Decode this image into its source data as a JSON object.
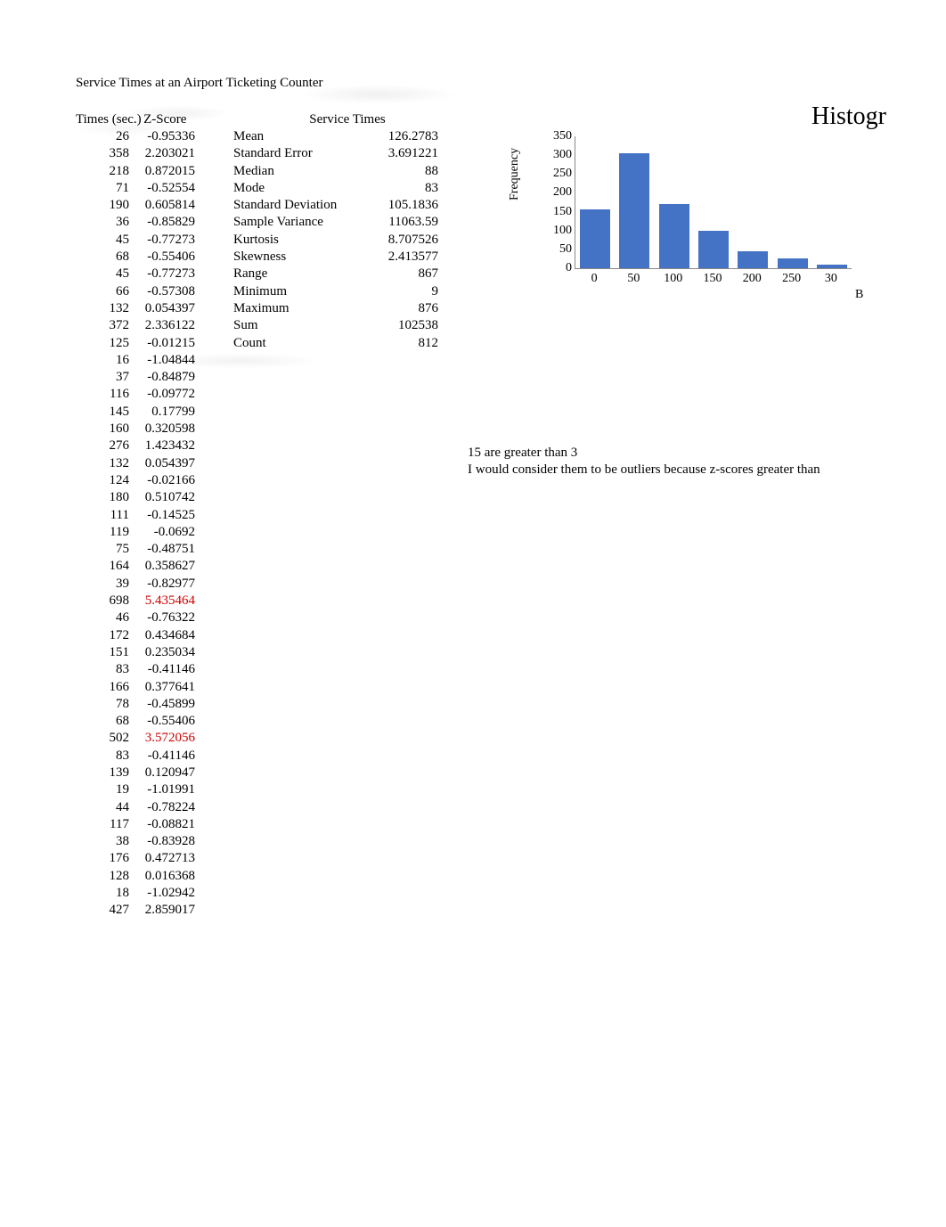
{
  "title": "Service Times at an Airport Ticketing Counter",
  "headers": {
    "times": "Times (sec.)",
    "zscore": "Z-Score"
  },
  "rows": [
    {
      "t": "26",
      "z": "-0.95336"
    },
    {
      "t": "358",
      "z": "2.203021"
    },
    {
      "t": "218",
      "z": "0.872015"
    },
    {
      "t": "71",
      "z": "-0.52554"
    },
    {
      "t": "190",
      "z": "0.605814"
    },
    {
      "t": "36",
      "z": "-0.85829"
    },
    {
      "t": "45",
      "z": "-0.77273"
    },
    {
      "t": "68",
      "z": "-0.55406"
    },
    {
      "t": "45",
      "z": "-0.77273"
    },
    {
      "t": "66",
      "z": "-0.57308"
    },
    {
      "t": "132",
      "z": "0.054397"
    },
    {
      "t": "372",
      "z": "2.336122"
    },
    {
      "t": "125",
      "z": "-0.01215"
    },
    {
      "t": "16",
      "z": "-1.04844"
    },
    {
      "t": "37",
      "z": "-0.84879"
    },
    {
      "t": "116",
      "z": "-0.09772"
    },
    {
      "t": "145",
      "z": "0.17799"
    },
    {
      "t": "160",
      "z": "0.320598"
    },
    {
      "t": "276",
      "z": "1.423432"
    },
    {
      "t": "132",
      "z": "0.054397"
    },
    {
      "t": "124",
      "z": "-0.02166"
    },
    {
      "t": "180",
      "z": "0.510742"
    },
    {
      "t": "111",
      "z": "-0.14525"
    },
    {
      "t": "119",
      "z": "-0.0692"
    },
    {
      "t": "75",
      "z": "-0.48751"
    },
    {
      "t": "164",
      "z": "0.358627"
    },
    {
      "t": "39",
      "z": "-0.82977"
    },
    {
      "t": "698",
      "z": "5.435464",
      "outlier": true
    },
    {
      "t": "46",
      "z": "-0.76322"
    },
    {
      "t": "172",
      "z": "0.434684"
    },
    {
      "t": "151",
      "z": "0.235034"
    },
    {
      "t": "83",
      "z": "-0.41146"
    },
    {
      "t": "166",
      "z": "0.377641"
    },
    {
      "t": "78",
      "z": "-0.45899"
    },
    {
      "t": "68",
      "z": "-0.55406"
    },
    {
      "t": "502",
      "z": "3.572056",
      "outlier": true
    },
    {
      "t": "83",
      "z": "-0.41146"
    },
    {
      "t": "139",
      "z": "0.120947"
    },
    {
      "t": "19",
      "z": "-1.01991"
    },
    {
      "t": "44",
      "z": "-0.78224"
    },
    {
      "t": "117",
      "z": "-0.08821"
    },
    {
      "t": "38",
      "z": "-0.83928"
    },
    {
      "t": "176",
      "z": "0.472713"
    },
    {
      "t": "128",
      "z": "0.016368"
    },
    {
      "t": "18",
      "z": "-1.02942"
    },
    {
      "t": "427",
      "z": "2.859017"
    }
  ],
  "stats": {
    "title": "Service Times",
    "items": [
      {
        "label": "",
        "value": ""
      },
      {
        "label": "Mean",
        "value": "126.2783"
      },
      {
        "label": "Standard Error",
        "value": "3.691221"
      },
      {
        "label": "Median",
        "value": "88"
      },
      {
        "label": "Mode",
        "value": "83"
      },
      {
        "label": "Standard Deviation",
        "value": "105.1836"
      },
      {
        "label": "Sample Variance",
        "value": "11063.59"
      },
      {
        "label": "Kurtosis",
        "value": "8.707526"
      },
      {
        "label": "Skewness",
        "value": "2.413577"
      },
      {
        "label": "Range",
        "value": "867"
      },
      {
        "label": "Minimum",
        "value": "9"
      },
      {
        "label": "Maximum",
        "value": "876"
      },
      {
        "label": "Sum",
        "value": "102538"
      },
      {
        "label": "Count",
        "value": "812"
      }
    ]
  },
  "notes": {
    "line1": "15 are greater than 3",
    "line2": "I would consider them to be outliers because z-scores greater than"
  },
  "chart_data": {
    "type": "bar",
    "title": "Histogr",
    "ylabel": "Frequency",
    "ylim": [
      0,
      350
    ],
    "yticks": [
      "0",
      "50",
      "100",
      "150",
      "200",
      "250",
      "300",
      "350"
    ],
    "categories": [
      "0",
      "50",
      "100",
      "150",
      "200",
      "250",
      "30"
    ],
    "values": [
      155,
      305,
      170,
      100,
      45,
      25,
      10
    ],
    "xaxis_suffix": "B"
  }
}
